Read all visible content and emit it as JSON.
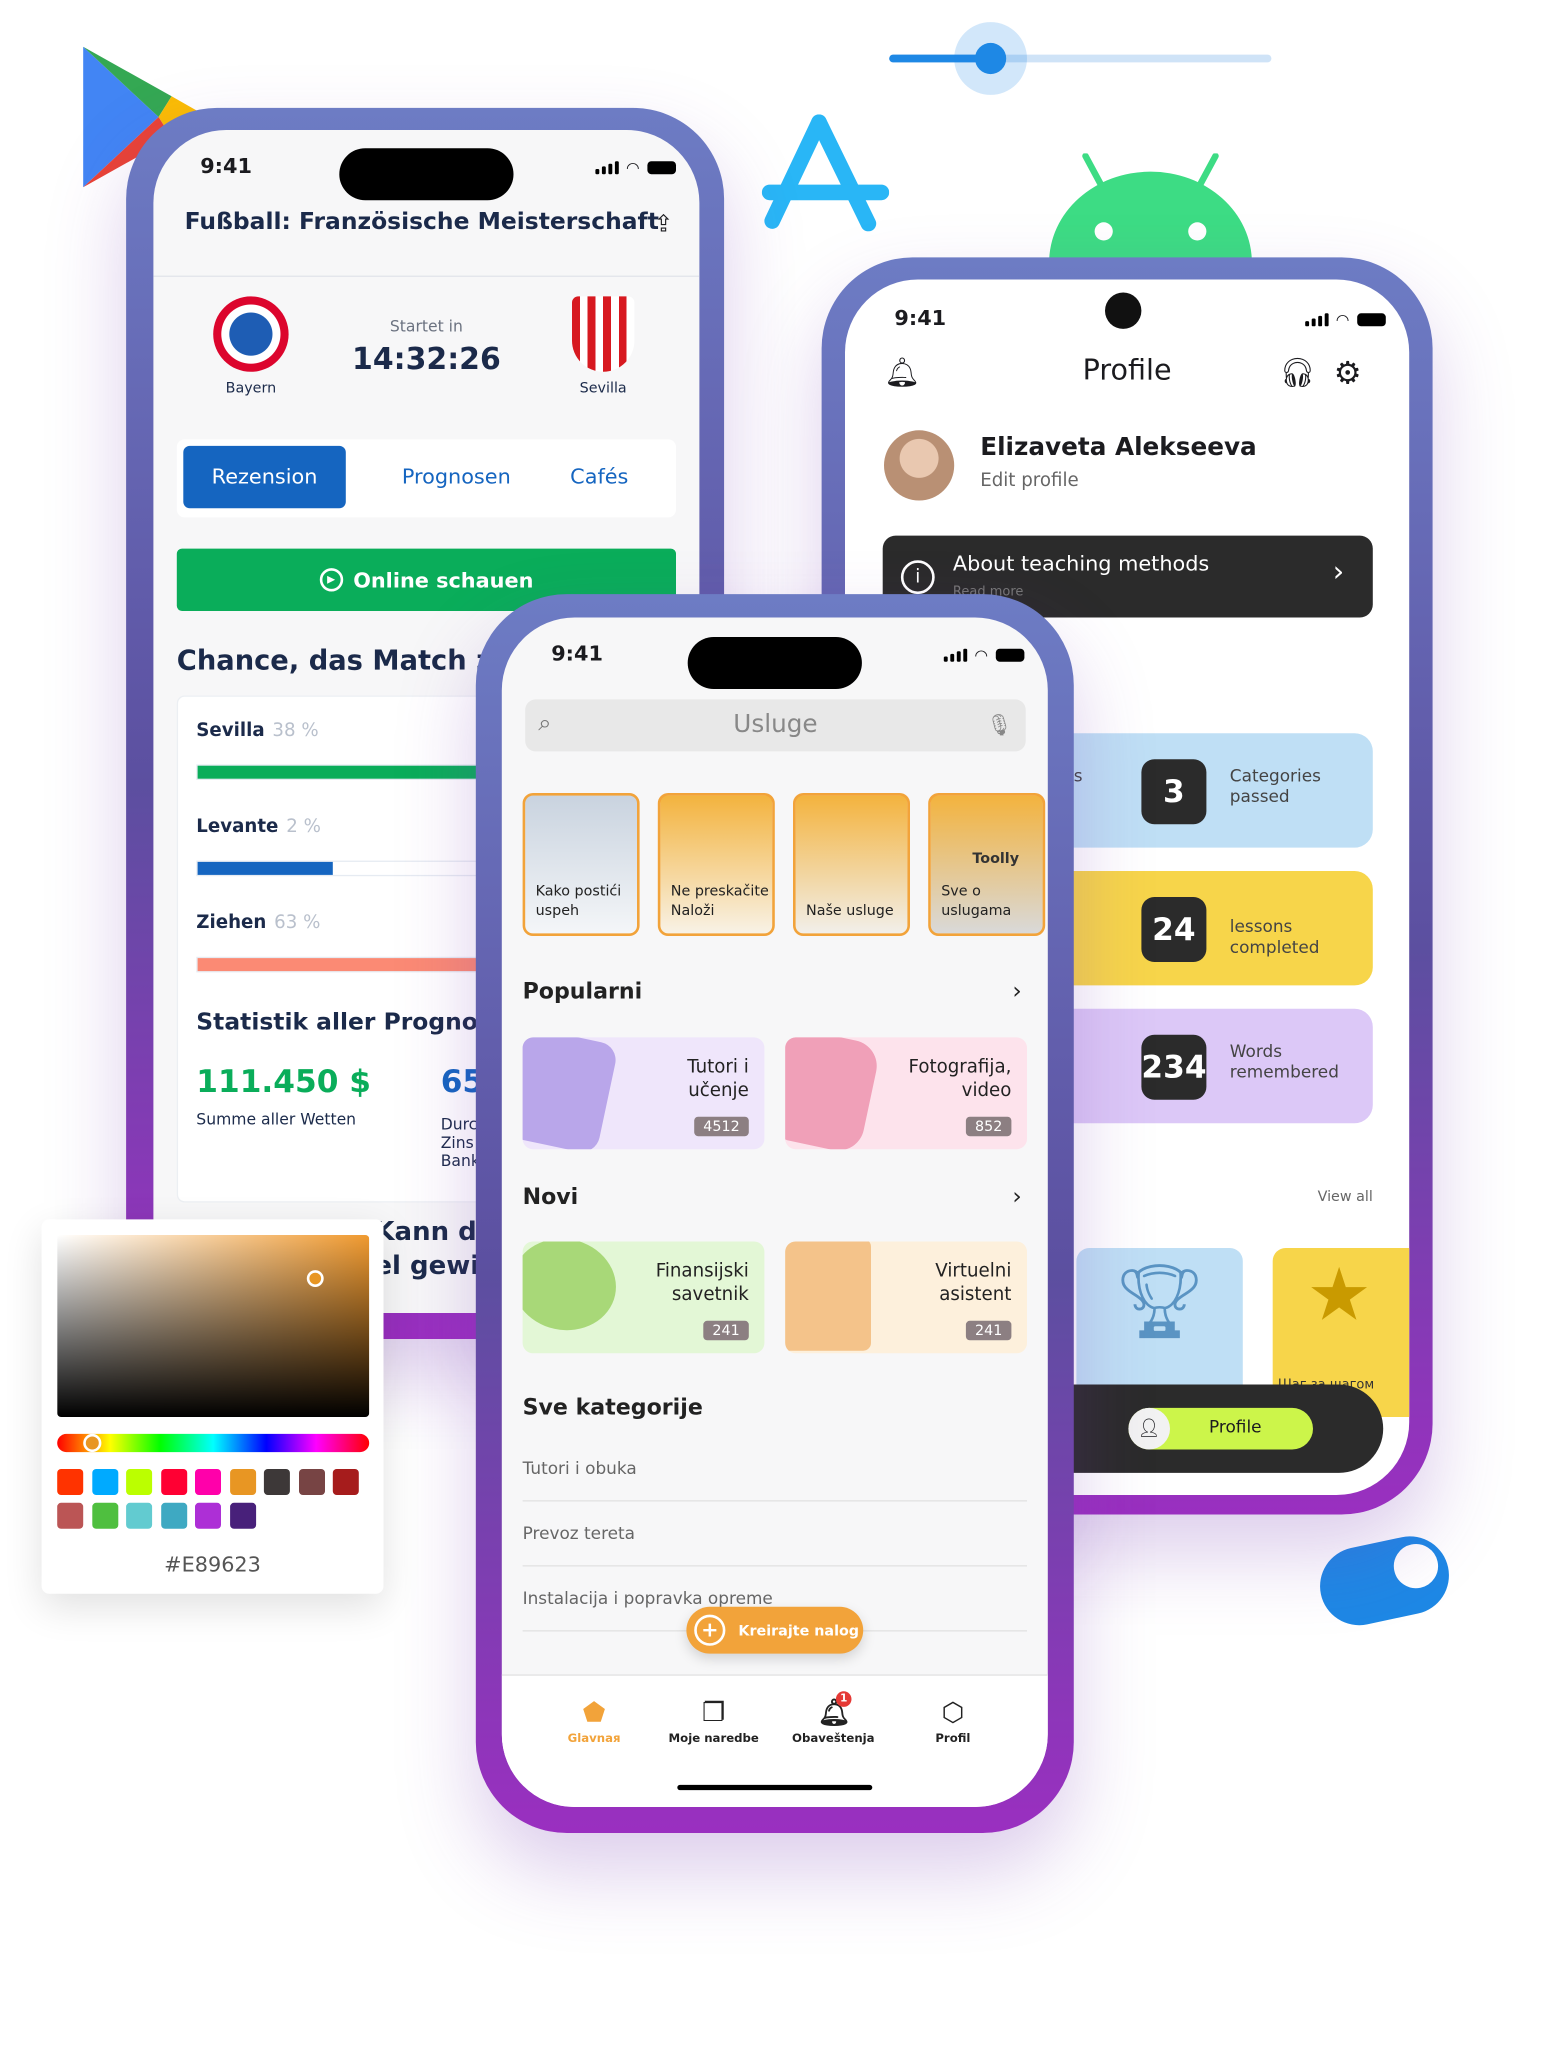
{
  "status_time": "9:41",
  "left_phone": {
    "title": "Fußball: Französische Meisterschaft",
    "home_team": "Bayern",
    "away_team": "Sevilla",
    "started_label": "Startet in",
    "timer": "14:32:26",
    "tabs": [
      {
        "label": "Rezension",
        "active": true
      },
      {
        "label": "Prognosen",
        "active": false
      },
      {
        "label": "Cafés",
        "active": false
      }
    ],
    "watch_button": "Online schauen",
    "chance_title": "Chance, das Match zu",
    "odds": [
      {
        "team": "Sevilla",
        "pct": "38 %",
        "fill": 100,
        "color": "#0aad5a"
      },
      {
        "team": "Levante",
        "pct": "2 %",
        "fill": 42,
        "color": "#1565c0"
      },
      {
        "team": "Ziehen",
        "pct": "63 %",
        "fill": 100,
        "color": "#fb8a74"
      }
    ],
    "stats_title": "Statistik aller Prognosen",
    "total_bets": "111.450 $",
    "total_bets_label": "Summe aller Wetten",
    "second_value": "65",
    "second_label_lines": [
      "Durc",
      "Zins",
      "Bank"
    ],
    "bottom_lines": [
      "Kann der",
      "el gewin"
    ]
  },
  "right_phone": {
    "title": "Profile",
    "user_name": "Elizaveta Alekseeva",
    "edit_profile": "Edit profile",
    "banner_title": "About teaching methods",
    "banner_sub": "Read more",
    "stats_left_partial": "s",
    "stats": [
      {
        "value": "3",
        "label": "Categories passed",
        "color": "#bfdff5"
      },
      {
        "value": "24",
        "label": "lessons completed",
        "color": "#f7d54a"
      },
      {
        "value": "234",
        "label": "Words remembered",
        "color": "#dcc8f7"
      }
    ],
    "view_all": "View all",
    "award_label": "Шаг за шагом",
    "nav_profile": "Profile"
  },
  "center_phone": {
    "search_placeholder": "Usluge",
    "stories": [
      "Kako postići uspeh",
      "Ne preskačite Naloži",
      "Naše usluge",
      "Sve o uslugama"
    ],
    "brand_mark": "Toolly",
    "popular_title": "Popularni",
    "popular": [
      {
        "title": "Tutori i učenje",
        "count": "4512",
        "bg": "#efe6fb",
        "blob": "#b9a6ea"
      },
      {
        "title": "Fotografija, video",
        "count": "852",
        "bg": "#fde3ec",
        "blob": "#f0a0b8"
      }
    ],
    "new_title": "Novi",
    "new": [
      {
        "title": "Finansijski savetnik",
        "count": "241",
        "bg": "#e3f7d6",
        "blob": "#a8d878"
      },
      {
        "title": "Virtuelni asistent",
        "count": "241",
        "bg": "#fdf0dc",
        "blob": "#f4c38a"
      }
    ],
    "categories_title": "Sve kategorije",
    "categories": [
      "Tutori i obuka",
      "Prevoz tereta",
      "Instalacija i popravka opreme"
    ],
    "fab": "Kreirajte nalog",
    "nav": [
      {
        "label": "Glavnaя",
        "active": true,
        "icon": "home-icon"
      },
      {
        "label": "Moje naredbe",
        "active": false,
        "icon": "orders-icon"
      },
      {
        "label": "Obaveštenja",
        "active": false,
        "icon": "bell-icon",
        "badge": "1"
      },
      {
        "label": "Profil",
        "active": false,
        "icon": "profile-icon"
      }
    ],
    "accent": "#f2a33a"
  },
  "color_picker": {
    "hex": "#E89623",
    "hue_position": 0.09,
    "swatches": [
      "#ff3300",
      "#00aaff",
      "#bbff00",
      "#ff0033",
      "#ff00aa",
      "#e89623",
      "#3d3838",
      "#774444",
      "#a61c1c",
      "#bb5555",
      "#4fbf3f",
      "#62cbd0",
      "#3ea9c2",
      "#ad2fd6",
      "#48207a"
    ]
  },
  "slider": {
    "value": 0.27
  },
  "toggle": {
    "on": true
  }
}
